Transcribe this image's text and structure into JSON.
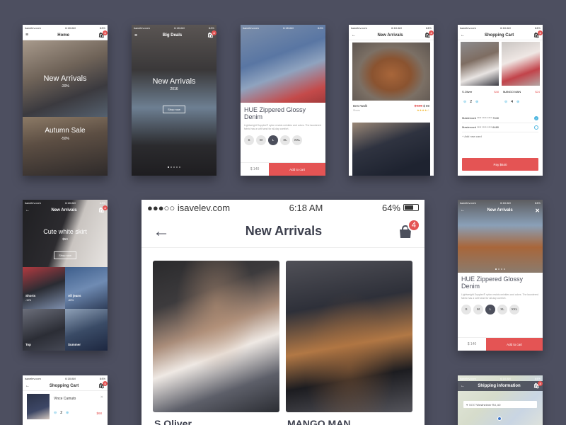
{
  "status": {
    "carrier": "●●●○○ isavelev.com",
    "carrier_short": "isavelev.com",
    "time": "6:18 AM",
    "battery": "64%"
  },
  "colors": {
    "accent": "#e45454",
    "background": "#4d4f60",
    "dark": "#4c4f5c"
  },
  "home": {
    "title": "Home",
    "badge": "4",
    "banner1_title": "New Arrivals",
    "banner1_sub": "-20%",
    "banner2_title": "Autumn Sale",
    "banner2_sub": "-50%"
  },
  "deals": {
    "title": "Big Deals",
    "banner_title": "New Arrivals",
    "banner_sub": "2016",
    "cta": "Shop now"
  },
  "product": {
    "name": "HUE Zippered Glossy Denim",
    "desc": "Lightweight Supplex® nylon resists wrinkles and odors. The laundered fabric has a soft hand for all-day comfort.",
    "sizes": [
      "S",
      "M",
      "L",
      "XL",
      "XXL"
    ],
    "selected_size": "L",
    "price": "$ 140",
    "add_to_cart": "Add to cart"
  },
  "arrivals_small": {
    "title": "New Arrivals",
    "item_name": "Best Walk",
    "item_brand": "Shoes",
    "old_price": "$ 100",
    "new_price": "$ 89",
    "stars": "★★★★☆"
  },
  "cart": {
    "title": "Shopping Cart",
    "item1_brand": "S.Oliver",
    "item1_price": "$48",
    "item1_qty": "2",
    "item2_brand": "MANGO MAN",
    "item2_price": "$24",
    "item2_qty": "4",
    "card1": "Mastercard **** **** **** 7040",
    "card2": "Mastercard **** **** **** 6480",
    "add_card": "Add new card",
    "pay": "Pay $640"
  },
  "skirt": {
    "title": "New Arrivals",
    "banner_title": "Cute white skirt",
    "banner_sub": "$50",
    "cta": "Shop now",
    "tiles": [
      {
        "label": "Shorts",
        "sub": "-10%"
      },
      {
        "label": "All jeans",
        "sub": "-50%"
      },
      {
        "label": "Top",
        "sub": ""
      },
      {
        "label": "Summer",
        "sub": ""
      }
    ]
  },
  "main": {
    "title": "New Arrivals",
    "badge": "4",
    "item1_brand": "S.Oliver",
    "item2_brand": "MANGO MAN"
  },
  "cart2": {
    "title": "Shopping Cart",
    "item_brand": "Vince Camuto",
    "item_qty": "2",
    "item_price": "$68"
  },
  "shipping": {
    "title": "Shipping information",
    "address": "5727 Westheimer Rd, #0"
  }
}
